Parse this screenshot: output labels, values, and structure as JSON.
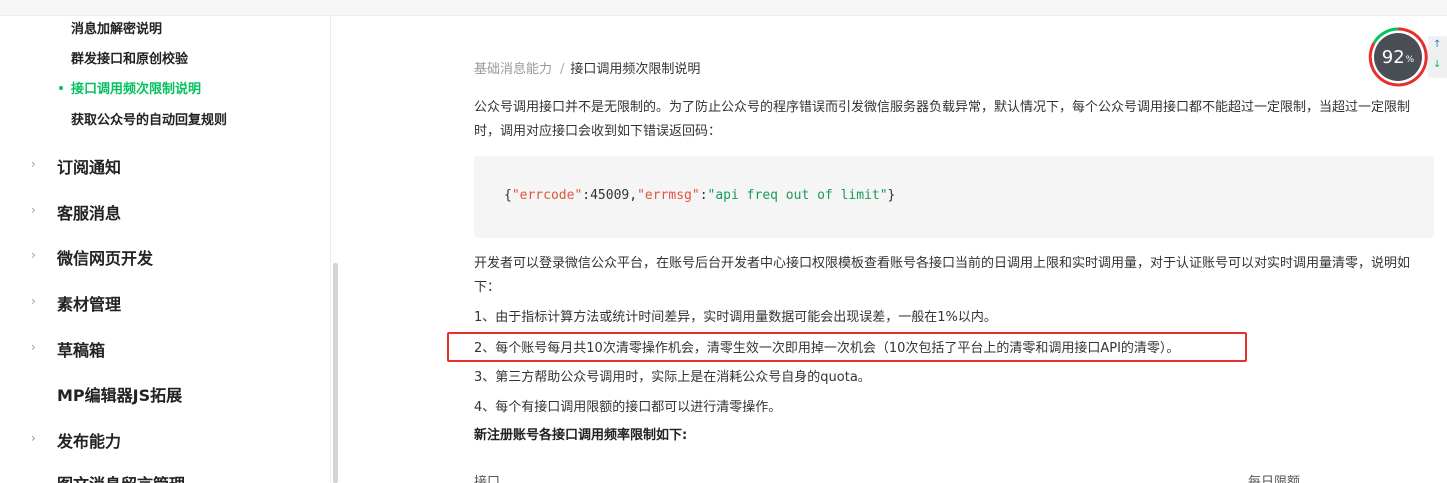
{
  "sidebar": {
    "sub_items": [
      {
        "label": "消息加解密说明"
      },
      {
        "label": "群发接口和原创校验"
      },
      {
        "label": "接口调用频次限制说明"
      },
      {
        "label": "获取公众号的自动回复规则"
      }
    ],
    "nav_items": [
      {
        "label": "订阅通知"
      },
      {
        "label": "客服消息"
      },
      {
        "label": "微信网页开发"
      },
      {
        "label": "素材管理"
      },
      {
        "label": "草稿箱"
      },
      {
        "label": "MP编辑器JS拓展"
      },
      {
        "label": "发布能力"
      },
      {
        "label": "图文消息留言管理"
      }
    ]
  },
  "breadcrumb": {
    "parent": "基础消息能力",
    "separator": "/",
    "current": "接口调用频次限制说明"
  },
  "content": {
    "intro": "公众号调用接口并不是无限制的。为了防止公众号的程序错误而引发微信服务器负载异常，默认情况下，每个公众号调用接口都不能超过一定限制，当超过一定限制时，调用对应接口会收到如下错误返回码：",
    "code": {
      "open": "{",
      "key1": "\"errcode\"",
      "colon1": ":",
      "val1": "45009",
      "comma": ",",
      "key2": "\"errmsg\"",
      "colon2": ":",
      "val2": "\"api freq out of limit\"",
      "close": "}"
    },
    "desc": "开发者可以登录微信公众平台，在账号后台开发者中心接口权限模板查看账号各接口当前的日调用上限和实时调用量，对于认证账号可以对实时调用量清零，说明如下：",
    "items": [
      "1、由于指标计算方法或统计时间差异，实时调用量数据可能会出现误差，一般在1%以内。",
      "2、每个账号每月共10次清零操作机会，清零生效一次即用掉一次机会（10次包括了平台上的清零和调用接口API的清零）。",
      "3、第三方帮助公众号调用时，实际上是在消耗公众号自身的quota。",
      "4、每个有接口调用限额的接口都可以进行清零操作。"
    ],
    "subheading": "新注册账号各接口调用频率限制如下:",
    "table_headers": [
      "接口",
      "每日限额"
    ]
  },
  "widget": {
    "percent": "92",
    "unit": "%",
    "up_arrow": "↑",
    "down_arrow": "↓"
  },
  "colors": {
    "accent": "#07c160",
    "highlight_border": "#e8302a"
  }
}
